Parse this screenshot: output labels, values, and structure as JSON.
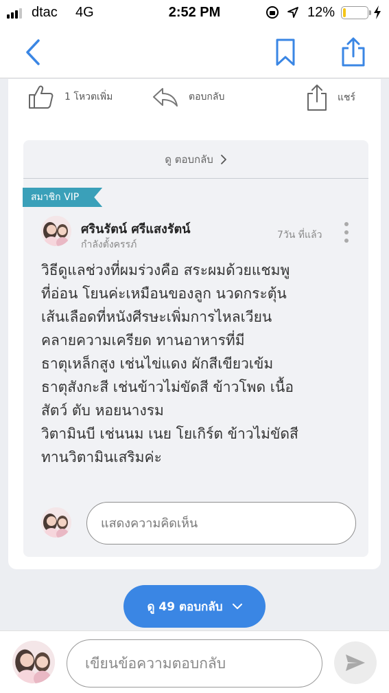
{
  "status_bar": {
    "carrier": "dtac",
    "network": "4G",
    "time": "2:52 PM",
    "battery_percent": "12%",
    "battery_level": 0.12,
    "battery_color": "#f5c518",
    "icons": [
      "signal-bars",
      "rotation-lock-icon",
      "location-arrow-icon",
      "battery-icon",
      "charging-bolt-icon"
    ]
  },
  "nav": {
    "icons": [
      "back-chevron-icon",
      "bookmark-icon",
      "share-icon"
    ],
    "accent_color": "#3a86e4"
  },
  "actions": {
    "vote_label": "1 โหวตเพิ่ม",
    "reply_label": "ตอบกลับ",
    "share_label": "แชร์"
  },
  "comment": {
    "view_replies_label": "ดู ตอบกลับ",
    "badge": "สมาชิก VIP",
    "badge_color": "#3aa0b9",
    "author_name": "ศรินรัตน์ ศรีแสงรัตน์",
    "author_status": "กำลังตั้งครรภ์",
    "time_ago": "7วัน ที่แล้ว",
    "body_lines": [
      "วิธีดูแลช่วงที่ผมร่วงคือ สระผมด้วยแชมพู",
      "ที่อ่อน โยนค่ะเหมือนของลูก นวดกระตุ้น",
      "เส้นเลือดที่หนังศีรษะเพิ่มการไหลเวียน",
      "คลายความเครียด ทานอาหารที่มี",
      "ธาตุเหล็กสูง เช่นไข่แดง ผักสีเขียวเข้ม",
      "ธาตุสังกะสี เช่นข้าวไม่ขัดสี ข้าวโพด เนื้อ",
      "สัตว์ ตับ หอยนางรม",
      "วิตามินบี เช่นนม เนย โยเกิร์ต ข้าวไม่ขัดสี",
      "ทานวิตามินเสริมค่ะ"
    ],
    "input_placeholder": "แสดงความคิดเห็น"
  },
  "load_more": {
    "label": "ดู 49 ตอบกลับ"
  },
  "reply_bar": {
    "placeholder": "เขียนข้อความตอบกลับ"
  }
}
